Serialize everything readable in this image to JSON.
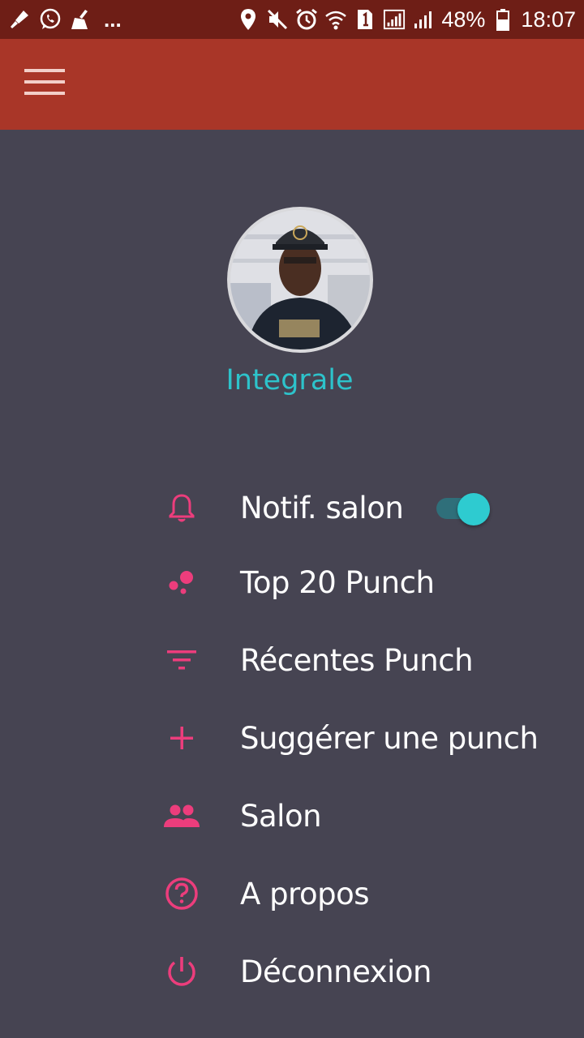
{
  "status_bar": {
    "left_icons": [
      "mic-icon",
      "whatsapp-icon",
      "cleaner-icon"
    ],
    "overflow": "...",
    "right_icons": [
      "location-icon",
      "mute-icon",
      "alarm-icon",
      "wifi-icon",
      "sim1-icon",
      "signal-icon",
      "signal-icon"
    ],
    "battery": "48%",
    "time": "18:07"
  },
  "app_bar": {
    "menu_icon": "hamburger-menu-icon",
    "color": "#a93628"
  },
  "profile": {
    "username": "Integrale",
    "username_color": "#2dc3cb"
  },
  "menu": {
    "accent_color": "#ec3d7c",
    "items": [
      {
        "icon": "bell-icon",
        "label": "Notif. salon",
        "toggle_on": true
      },
      {
        "icon": "bubbles-icon",
        "label": "Top 20 Punch"
      },
      {
        "icon": "filter-icon",
        "label": "Récentes Punch"
      },
      {
        "icon": "plus-icon",
        "label": "Suggérer une punch"
      },
      {
        "icon": "people-icon",
        "label": "Salon"
      },
      {
        "icon": "help-circle-icon",
        "label": "A propos"
      },
      {
        "icon": "power-icon",
        "label": "Déconnexion"
      }
    ]
  }
}
